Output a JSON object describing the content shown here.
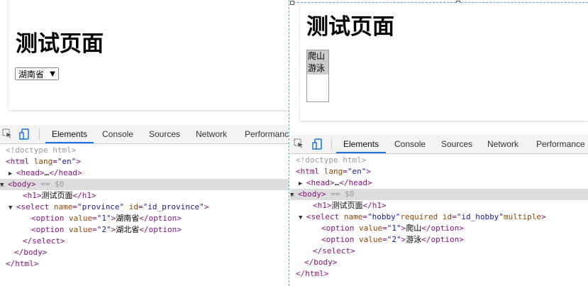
{
  "left": {
    "page": {
      "heading": "测试页面",
      "select_value": "湖南省",
      "select_arrow": "▼"
    },
    "devtools": {
      "tabs": [
        "Elements",
        "Console",
        "Sources",
        "Network",
        "Performance"
      ],
      "active_tab": "Elements",
      "lines": [
        {
          "indent": 0,
          "text": "<!doctype html>",
          "style": "gray"
        },
        {
          "indent": 0,
          "text": "<html lang=\"en\">"
        },
        {
          "indent": 1,
          "toggle": "▶",
          "text": "<head>…</head>"
        },
        {
          "indent": 0,
          "toggle": "▼",
          "prefix": "…",
          "text": "<body>",
          "suffix": " == $0",
          "selected": true
        },
        {
          "indent": 2,
          "text": "<h1>测试页面</h1>"
        },
        {
          "indent": 1,
          "toggle": "▼",
          "text": "<select name=\"province\" id=\"id_province\">"
        },
        {
          "indent": 3,
          "text": "<option value=\"1\">湖南省</option>"
        },
        {
          "indent": 3,
          "text": "<option value=\"2\">湖北省</option>"
        },
        {
          "indent": 2,
          "text": "</select>"
        },
        {
          "indent": 1,
          "text": "</body>"
        },
        {
          "indent": 0,
          "text": "</html>"
        }
      ]
    }
  },
  "right": {
    "page": {
      "heading": "测试页面",
      "options": [
        "爬山",
        "游泳"
      ]
    },
    "devtools": {
      "tabs": [
        "Elements",
        "Console",
        "Sources",
        "Network",
        "Performance"
      ],
      "active_tab": "Elements",
      "lines": [
        {
          "indent": 0,
          "text": "<!doctype html>",
          "style": "gray"
        },
        {
          "indent": 0,
          "text": "<html lang=\"en\">"
        },
        {
          "indent": 1,
          "toggle": "▶",
          "text": "<head>…</head>"
        },
        {
          "indent": 0,
          "toggle": "▼",
          "prefix": "…",
          "text": "<body>",
          "suffix": " == $0",
          "selected": true
        },
        {
          "indent": 2,
          "text": "<h1>测试页面</h1>"
        },
        {
          "indent": 1,
          "toggle": "▼",
          "text": "<select name=\"hobby\" required id=\"id_hobby\" multiple>"
        },
        {
          "indent": 3,
          "text": "<option value=\"1\">爬山</option>"
        },
        {
          "indent": 3,
          "text": "<option value=\"2\">游泳</option>"
        },
        {
          "indent": 2,
          "text": "</select>"
        },
        {
          "indent": 1,
          "text": "</body>"
        },
        {
          "indent": 0,
          "text": "</html>"
        }
      ]
    }
  },
  "colors": {
    "accent": "#1a73e8",
    "tag": "#881280",
    "attr": "#994500",
    "value": "#1a1aa6"
  }
}
